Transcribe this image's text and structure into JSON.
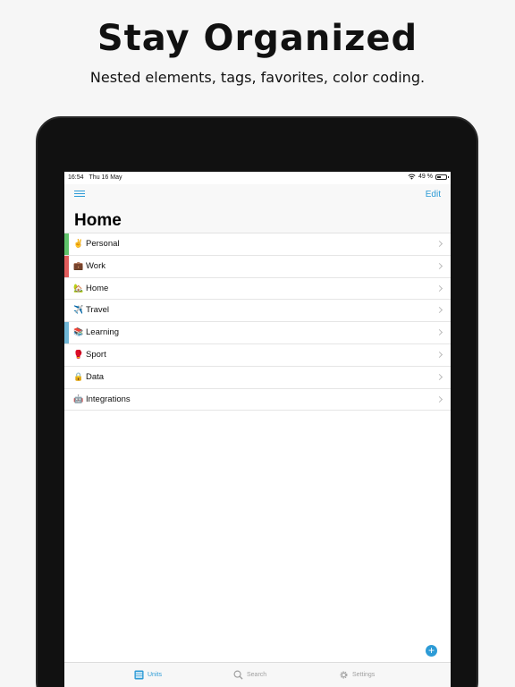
{
  "promo": {
    "title": "Stay Organized",
    "subtitle": "Nested elements, tags, favorites, color coding."
  },
  "status_bar": {
    "time": "16:54",
    "date": "Thu 16 May",
    "battery": "49 %",
    "battery_level": 0.49
  },
  "nav": {
    "edit_label": "Edit",
    "title": "Home"
  },
  "list": [
    {
      "label": "Personal",
      "emoji": "✌️",
      "color": "#5ec26a"
    },
    {
      "label": "Work",
      "emoji": "💼",
      "color": "#e05c5c"
    },
    {
      "label": "Home",
      "emoji": "🏡",
      "color": ""
    },
    {
      "label": "Travel",
      "emoji": "✈️",
      "color": ""
    },
    {
      "label": "Learning",
      "emoji": "📚",
      "color": "#6fb6d6"
    },
    {
      "label": "Sport",
      "emoji": "🥊",
      "color": ""
    },
    {
      "label": "Data",
      "emoji": "🔒",
      "color": ""
    },
    {
      "label": "Integrations",
      "emoji": "🤖",
      "color": ""
    }
  ],
  "fab_label": "+",
  "tabs": [
    {
      "label": "Units",
      "icon": "units-icon",
      "active": true
    },
    {
      "label": "Search",
      "icon": "search-icon",
      "active": false
    },
    {
      "label": "Settings",
      "icon": "gear-icon",
      "active": false
    }
  ],
  "colors": {
    "accent": "#2d9bd6"
  }
}
